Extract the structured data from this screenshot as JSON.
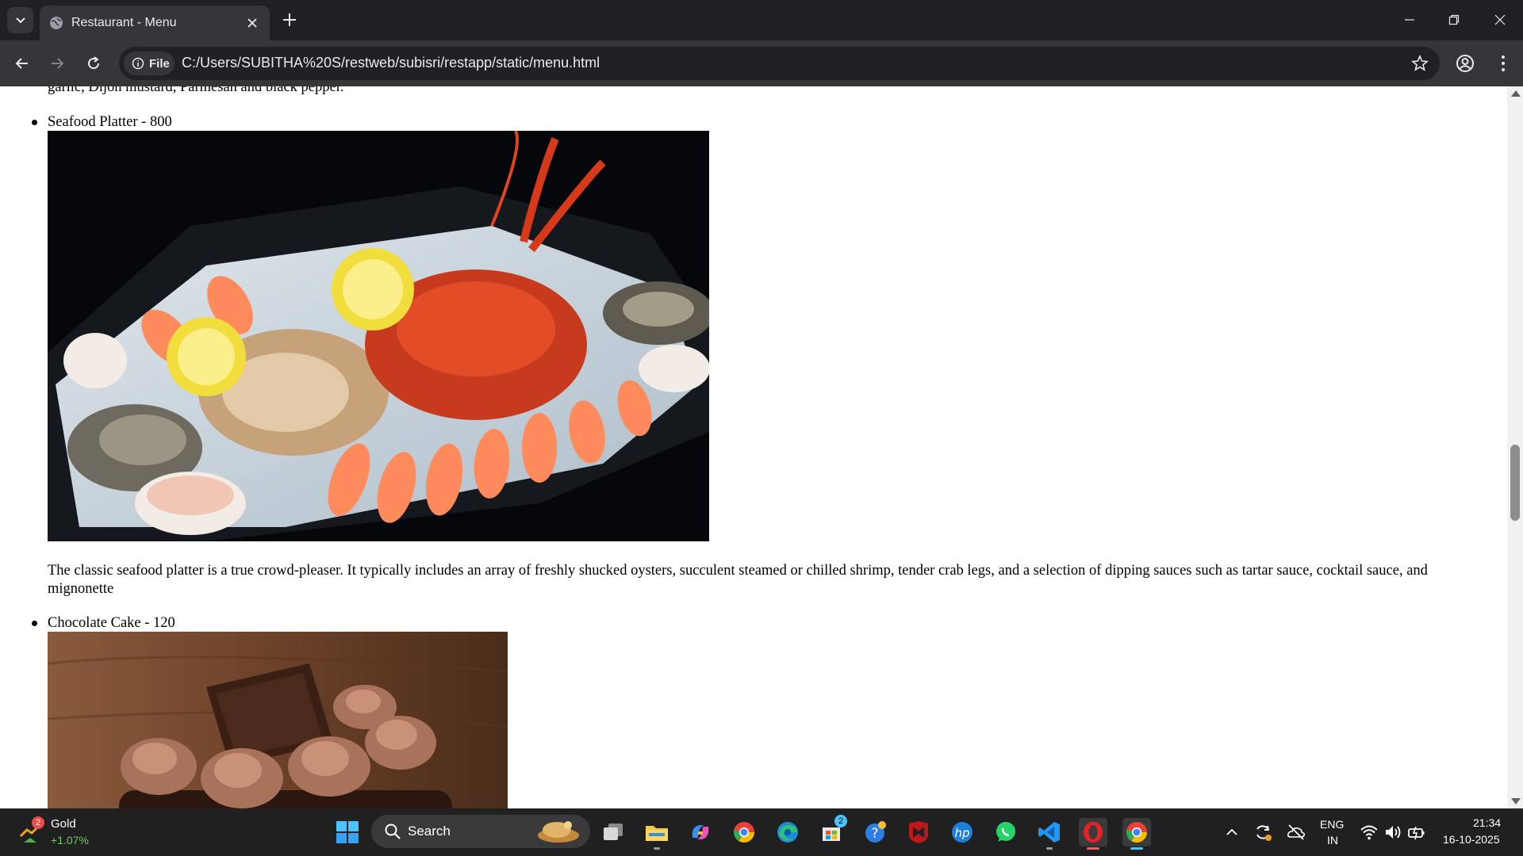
{
  "browser": {
    "tab_title": "Restaurant - Menu",
    "chip_label": "File",
    "url": "C:/Users/SUBITHA%20S/restweb/subisri/restapp/static/menu.html"
  },
  "page": {
    "cut_text": "garlic, Dijon mustard, Parmesan and black pepper.",
    "items": [
      {
        "title": "Seafood Platter - 800",
        "image": "seafood-platter-photo",
        "description": "The classic seafood platter is a true crowd-pleaser. It typically includes an array of freshly shucked oysters, succulent steamed or chilled shrimp, tender crab legs, and a selection of dipping sauces such as tartar sauce, cocktail sauce, and mignonette"
      },
      {
        "title": "Chocolate Cake - 120",
        "image": "chocolate-cake-photo"
      }
    ]
  },
  "taskbar": {
    "widget": {
      "title": "Gold",
      "change": "+1.07%",
      "badge": "2"
    },
    "search_label": "Search",
    "store_badge": "2",
    "pinned_apps": [
      "start-icon",
      "task-view-icon",
      "file-explorer-icon",
      "copilot-icon",
      "chrome-icon",
      "edge-icon",
      "microsoft-store-icon",
      "get-help-icon",
      "mcafee-icon",
      "hp-icon",
      "whatsapp-icon",
      "vscode-icon",
      "opera-icon",
      "chrome-active-icon"
    ],
    "tray": {
      "lang_top": "ENG",
      "lang_bottom": "IN",
      "time": "21:34",
      "date": "16-10-2025"
    }
  },
  "colors": {
    "chrome_dark": "#202124",
    "chrome_toolbar": "#35363a",
    "taskbar": "#202020",
    "widget_positive": "#6ccb5f"
  }
}
